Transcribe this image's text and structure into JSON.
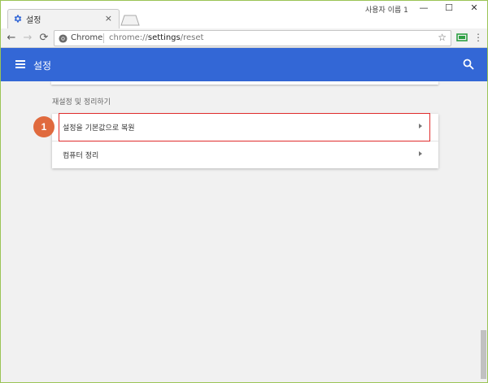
{
  "browser": {
    "tab_title": "설정",
    "tab_close": "×",
    "profile": "사용자 이름 1",
    "window_controls": {
      "minimize": "—",
      "maximize": "☐",
      "close": "✕"
    },
    "nav": {
      "back": "←",
      "forward": "→",
      "reload": "⟳"
    },
    "omnibox": {
      "site_label": "Chrome",
      "url_scheme": "chrome://",
      "url_host": "settings",
      "url_path": "/reset",
      "star": "☆"
    },
    "menu": "⋮"
  },
  "appbar": {
    "title": "설정",
    "color": "#3367d6"
  },
  "section": {
    "title": "재설정 및 정리하기",
    "rows": [
      {
        "label": "설정을 기본값으로 복원"
      },
      {
        "label": "컴퓨터 정리"
      }
    ]
  },
  "annotation": {
    "badge": "1",
    "badge_color": "#e06a3e",
    "highlight_color": "#e02d2d"
  },
  "icons": {
    "tab_favicon": "gear-icon",
    "omnibox": "chrome-icon",
    "search": "search-icon",
    "extension": "cast-icon"
  }
}
